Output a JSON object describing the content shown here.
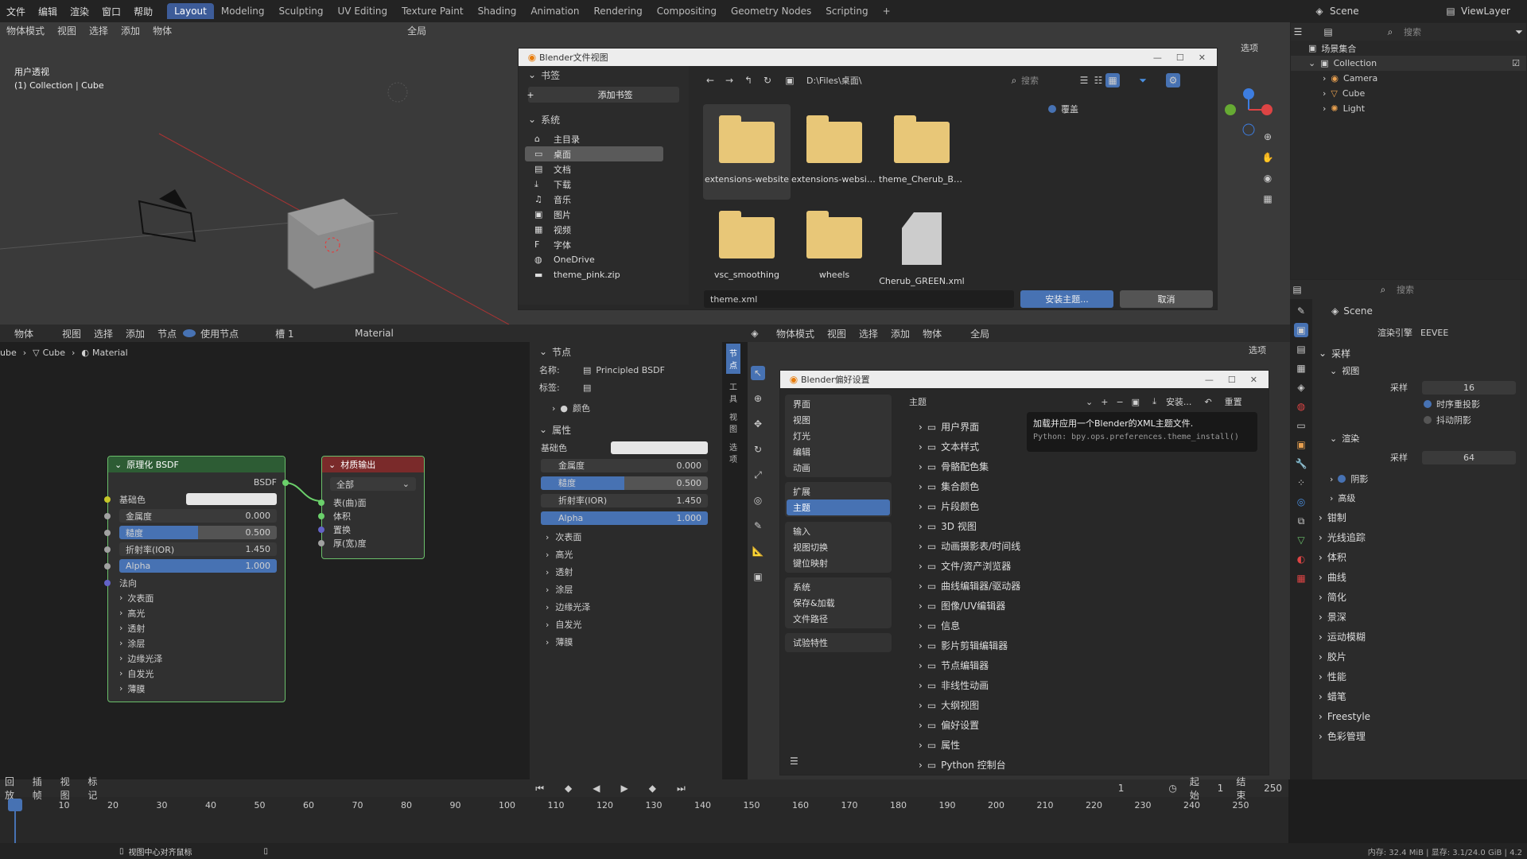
{
  "menu": {
    "items": [
      "文件",
      "编辑",
      "渲染",
      "窗口",
      "帮助"
    ]
  },
  "workspaces": {
    "tabs": [
      "Layout",
      "Modeling",
      "Sculpting",
      "UV Editing",
      "Texture Paint",
      "Shading",
      "Animation",
      "Rendering",
      "Compositing",
      "Geometry Nodes",
      "Scripting"
    ],
    "add": "+"
  },
  "top_right": {
    "scene": "Scene",
    "view_layer": "ViewLayer"
  },
  "viewport": {
    "mode": "物体模式",
    "menus": [
      "视图",
      "选择",
      "添加",
      "物体"
    ],
    "transform": "全局",
    "info_title": "用户透视",
    "info_sub": "(1) Collection | Cube",
    "select_btn": "选项"
  },
  "file_dialog": {
    "title": "Blender文件视图",
    "bookmarks_title": "书签",
    "add_bookmark": "添加书签",
    "system_title": "系统",
    "system_items": [
      {
        "icon": "home-icon",
        "glyph": "⌂",
        "label": "主目录"
      },
      {
        "icon": "desktop-icon",
        "glyph": "▭",
        "label": "桌面"
      },
      {
        "icon": "documents-icon",
        "glyph": "▤",
        "label": "文档"
      },
      {
        "icon": "download-icon",
        "glyph": "⤓",
        "label": "下载"
      },
      {
        "icon": "music-icon",
        "glyph": "♫",
        "label": "音乐"
      },
      {
        "icon": "image-icon",
        "glyph": "▣",
        "label": "图片"
      },
      {
        "icon": "video-icon",
        "glyph": "▦",
        "label": "视频"
      },
      {
        "icon": "font-icon",
        "glyph": "F",
        "label": "字体"
      },
      {
        "icon": "globe-icon",
        "glyph": "◍",
        "label": "OneDrive"
      },
      {
        "icon": "folder-icon",
        "glyph": "▬",
        "label": "theme_pink.zip"
      }
    ],
    "path": "D:\\Files\\桌面\\",
    "search_placeholder": "搜索",
    "overwrite": "覆盖",
    "files": [
      {
        "name": "extensions-website",
        "type": "folder"
      },
      {
        "name": "extensions-websit···",
        "type": "folder"
      },
      {
        "name": "theme_Cherub_BLUE",
        "type": "folder"
      },
      {
        "name": "vsc_smoothing",
        "type": "folder"
      },
      {
        "name": "wheels",
        "type": "folder"
      },
      {
        "name": "Cherub_GREEN.xml",
        "type": "file"
      }
    ],
    "filename": "theme.xml",
    "install_btn": "安装主题...",
    "cancel_btn": "取消"
  },
  "outliner": {
    "search_placeholder": "搜索",
    "root": "场景集合",
    "collection": "Collection",
    "items": [
      "Camera",
      "Cube",
      "Light"
    ]
  },
  "node_editor": {
    "header": {
      "object": "物体",
      "menus": [
        "视图",
        "选择",
        "添加",
        "节点"
      ],
      "use_nodes": "使用节点",
      "slot": "槽 1",
      "material": "Material"
    },
    "breadcrumb": [
      "ube",
      "Cube",
      "Material"
    ],
    "bsdf_node": {
      "title": "原理化 BSDF",
      "output": "BSDF",
      "base_color": "基础色",
      "metallic": {
        "label": "金属度",
        "value": "0.000"
      },
      "roughness": {
        "label": "糙度",
        "value": "0.500",
        "fill": 0.5
      },
      "ior": {
        "label": "折射率(IOR)",
        "value": "1.450"
      },
      "alpha": {
        "label": "Alpha",
        "value": "1.000",
        "fill": 1
      },
      "normal": "法向",
      "subpanels": [
        "次表面",
        "高光",
        "透射",
        "涂层",
        "边缘光泽",
        "自发光",
        "薄膜"
      ]
    },
    "output_node": {
      "title": "材质输出",
      "target": "全部",
      "inputs": [
        "表(曲)面",
        "体积",
        "置换",
        "厚(宽)度"
      ]
    }
  },
  "node_sidebar": {
    "section": "节点",
    "name_label": "名称:",
    "name_value": "Principled BSDF",
    "label_label": "标签:",
    "color": "颜色",
    "props_title": "属性",
    "base_color": "基础色",
    "metallic": {
      "label": "金属度",
      "value": "0.000"
    },
    "roughness": {
      "label": "糙度",
      "value": "0.500",
      "fill": 0.5
    },
    "ior": {
      "label": "折射率(IOR)",
      "value": "1.450"
    },
    "alpha": {
      "label": "Alpha",
      "value": "1.000",
      "fill": 1
    },
    "subpanels": [
      "次表面",
      "高光",
      "透射",
      "涂层",
      "边缘光泽",
      "自发光",
      "薄膜"
    ],
    "tabs": [
      "节点",
      "工具",
      "视图",
      "选项"
    ]
  },
  "viewport2": {
    "mode": "物体模式",
    "menus": [
      "视图",
      "选择",
      "添加",
      "物体"
    ],
    "transform": "全局",
    "select_btn": "选项"
  },
  "prefs": {
    "title": "Blender偏好设置",
    "nav_groups": [
      [
        "界面",
        "视图",
        "灯光",
        "编辑",
        "动画"
      ],
      [
        "扩展",
        "主题"
      ],
      [
        "输入",
        "视图切换",
        "键位映射"
      ],
      [
        "系统",
        "保存&加载",
        "文件路径"
      ],
      [
        "试验特性"
      ]
    ],
    "selected": "主题",
    "theme_label": "主题",
    "install_btn": "安装...",
    "reset_btn": "重置",
    "tooltip_title": "加载并应用一个Blender的XML主题文件.",
    "tooltip_python": "Python: bpy.ops.preferences.theme_install()",
    "theme_items": [
      "用户界面",
      "文本样式",
      "骨骼配色集",
      "集合颜色",
      "片段颜色",
      "3D 视图",
      "动画摄影表/时间线",
      "文件/资产浏览器",
      "曲线编辑器/驱动器",
      "图像/UV编辑器",
      "信息",
      "影片剪辑编辑器",
      "节点编辑器",
      "非线性动画",
      "大纲视图",
      "偏好设置",
      "属性",
      "Python 控制台"
    ]
  },
  "properties": {
    "search_placeholder": "搜索",
    "scene": "Scene",
    "render_engine_label": "渲染引擎",
    "render_engine": "EEVEE",
    "sampling": "采样",
    "viewport": "视图",
    "viewport_samples_label": "采样",
    "viewport_samples": "16",
    "temporal_reprojection": "时序重投影",
    "jitter_shadows": "抖动阴影",
    "render": "渲染",
    "render_samples_label": "采样",
    "render_samples": "64",
    "shadows": "阴影",
    "advanced": "高级",
    "sections": [
      "钳制",
      "光线追踪",
      "体积",
      "曲线",
      "简化",
      "景深",
      "运动模糊",
      "胶片",
      "性能",
      "蜡笔",
      "Freestyle",
      "色彩管理"
    ]
  },
  "timeline": {
    "playback": "回放",
    "keying": "插帧",
    "view": "视图",
    "marker": "标记",
    "current_frame": "1",
    "start_label": "起始",
    "start": "1",
    "end_label": "结束",
    "end": "250",
    "ticks": [
      "1",
      "10",
      "20",
      "30",
      "40",
      "50",
      "60",
      "70",
      "80",
      "90",
      "100",
      "110",
      "120",
      "130",
      "140",
      "150",
      "160",
      "170",
      "180",
      "190",
      "200",
      "210",
      "220",
      "230",
      "240",
      "250"
    ]
  },
  "statusbar": {
    "hint": "视图中心对齐鼠标",
    "memory": "内存: 32.4 MiB | 显存: 3.1/24.0 GiB | 4.2"
  }
}
